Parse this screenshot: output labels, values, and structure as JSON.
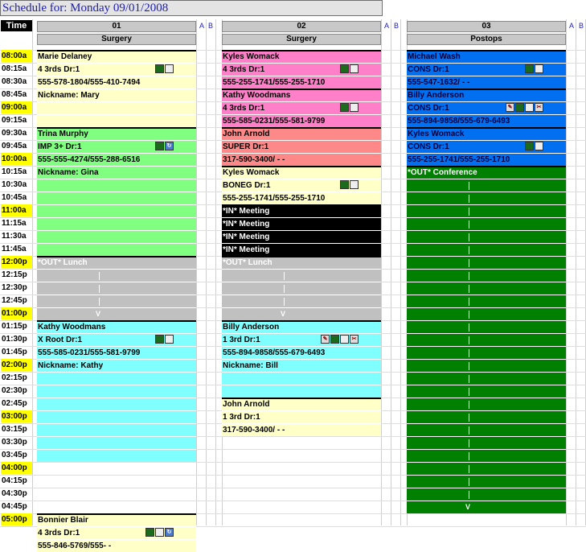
{
  "header": {
    "title": "Schedule for: Monday 09/01/2008"
  },
  "time_header": "Time",
  "times": [
    "08:00a",
    "08:15a",
    "08:30a",
    "08:45a",
    "09:00a",
    "09:15a",
    "09:30a",
    "09:45a",
    "10:00a",
    "10:15a",
    "10:30a",
    "10:45a",
    "11:00a",
    "11:15a",
    "11:30a",
    "11:45a",
    "12:00p",
    "12:15p",
    "12:30p",
    "12:45p",
    "01:00p",
    "01:15p",
    "01:30p",
    "01:45p",
    "02:00p",
    "02:15p",
    "02:30p",
    "02:45p",
    "03:00p",
    "03:15p",
    "03:30p",
    "03:45p",
    "04:00p",
    "04:15p",
    "04:30p",
    "04:45p",
    "05:00p"
  ],
  "columns": [
    {
      "number": "01",
      "name": "Surgery",
      "a_label": "A",
      "b_label": "B"
    },
    {
      "number": "02",
      "name": "Surgery",
      "a_label": "A",
      "b_label": "B"
    },
    {
      "number": "03",
      "name": "Postops",
      "a_label": "A",
      "b_label": "B"
    }
  ],
  "colors": {
    "yellow": "#ffffc8",
    "green": "#80ff80",
    "pink": "#ff7fc8",
    "salmon": "#ff8888",
    "cyan": "#80ffff",
    "gray": "#c0c0c0",
    "black": "#000000",
    "blue": "#0070f0",
    "darkgreen": "#008000",
    "hour": "#ffff00"
  },
  "appointments": {
    "col1": [
      {
        "name": "Marie Delaney",
        "detail": "4 3rds Dr:1",
        "phone": "555-578-1804/555-410-7494",
        "nickname": "Nickname: Mary",
        "color": "yellow",
        "icons": [
          "car-icon",
          "doc-icon"
        ]
      },
      {
        "name": "Trina Murphy",
        "detail": "IMP 3+ Dr:1",
        "phone": "555-555-4274/555-288-6516",
        "nickname": "Nickname: Gina",
        "color": "green",
        "icons": [
          "car-icon",
          "refresh-icon"
        ]
      },
      {
        "name": "*OUT* Lunch",
        "color": "gray"
      },
      {
        "name": "Kathy Woodmans",
        "detail": "X Root Dr:1",
        "phone": "555-585-0231/555-581-9799",
        "nickname": "Nickname: Kathy",
        "color": "cyan",
        "icons": [
          "car-icon",
          "doc-icon"
        ]
      },
      {
        "name": "Bonnier Blair",
        "detail": "4 3rds Dr:1",
        "phone": "555-846-5769/555-   -",
        "color": "yellow",
        "icons": [
          "car-icon",
          "doc-icon",
          "refresh-icon"
        ]
      }
    ],
    "col2": [
      {
        "name": "Kyles Womack",
        "detail": "4 3rds Dr:1",
        "phone": "555-255-1741/555-255-1710",
        "color": "pink",
        "icons": [
          "car-icon",
          "doc-icon"
        ]
      },
      {
        "name": "Kathy Woodmans",
        "detail": "4 3rds Dr:1",
        "phone": "555-585-0231/555-581-9799",
        "color": "pink",
        "icons": [
          "car-icon",
          "doc-icon"
        ]
      },
      {
        "name": "John Arnold",
        "detail": "SUPER Dr:1",
        "phone": "317-590-3400/   -   -",
        "color": "salmon"
      },
      {
        "name": "Kyles Womack",
        "detail": "BONEG Dr:1",
        "phone": "555-255-1741/555-255-1710",
        "color": "yellow",
        "icons": [
          "car-icon",
          "doc-icon"
        ]
      },
      {
        "name": "*IN* Meeting",
        "color": "black"
      },
      {
        "name": "*OUT* Lunch",
        "color": "gray"
      },
      {
        "name": "Billy Anderson",
        "detail": "1 3rd Dr:1",
        "phone": "555-894-9858/555-679-6493",
        "nickname": "Nickname: Bill",
        "color": "cyan",
        "icons": [
          "note-icon",
          "car-icon",
          "doc-icon",
          "tool-icon"
        ]
      },
      {
        "name": "John Arnold",
        "detail": "1 3rd Dr:1",
        "phone": "317-590-3400/   -   -",
        "color": "yellow"
      }
    ],
    "col3": [
      {
        "name": "Michael Wash",
        "detail": "CONS Dr:1",
        "phone": "555-547-1632/   -   -",
        "color": "blue",
        "icons": [
          "car-icon",
          "doc-icon"
        ]
      },
      {
        "name": "Billy Anderson",
        "detail": "CONS Dr:1",
        "phone": "555-894-9858/555-679-6493",
        "color": "blue",
        "icons": [
          "note-icon",
          "car-icon",
          "doc-icon",
          "tool-icon"
        ]
      },
      {
        "name": "Kyles Womack",
        "detail": "CONS Dr:1",
        "phone": "555-255-1741/555-255-1710",
        "color": "blue",
        "icons": [
          "car-icon",
          "doc-icon"
        ]
      },
      {
        "name": "*OUT* Conference",
        "color": "darkgreen"
      }
    ]
  },
  "arrow_label": "V"
}
